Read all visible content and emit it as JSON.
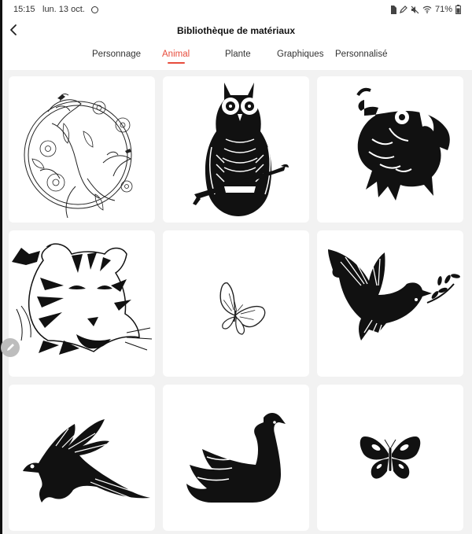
{
  "status_bar": {
    "time": "15:15",
    "date": "lun. 13 oct.",
    "battery": "71%",
    "icons": [
      "focus-dot-icon",
      "sd-card-icon",
      "pen-icon",
      "mute-icon",
      "wifi-icon",
      "battery-icon"
    ]
  },
  "header": {
    "title": "Bibliothèque de matériaux",
    "back_icon": "chevron-left-icon"
  },
  "tabs": [
    {
      "label": "Personnage",
      "active": false
    },
    {
      "label": "Animal",
      "active": true
    },
    {
      "label": "Plante",
      "active": false
    },
    {
      "label": "Graphiques",
      "active": false
    },
    {
      "label": "Personnalisé",
      "active": false
    }
  ],
  "colors": {
    "accent": "#e74c3c",
    "grid_background": "#f2f2f2",
    "card": "#ffffff",
    "ink": "#111111"
  },
  "materials": [
    {
      "subject": "birds-and-flowers-mandala",
      "icon": "birds-flowers-image"
    },
    {
      "subject": "owl-on-branch",
      "icon": "owl-image"
    },
    {
      "subject": "parrot-head",
      "icon": "parrot-image"
    },
    {
      "subject": "tiger-head",
      "icon": "tiger-image"
    },
    {
      "subject": "small-butterfly",
      "icon": "butterfly-image"
    },
    {
      "subject": "dove-with-olive-branch",
      "icon": "dove-image"
    },
    {
      "subject": "flying-macaw",
      "icon": "macaw-image"
    },
    {
      "subject": "swan",
      "icon": "swan-image"
    },
    {
      "subject": "butterfly-silhouette",
      "icon": "butterfly-silhouette-image"
    }
  ]
}
